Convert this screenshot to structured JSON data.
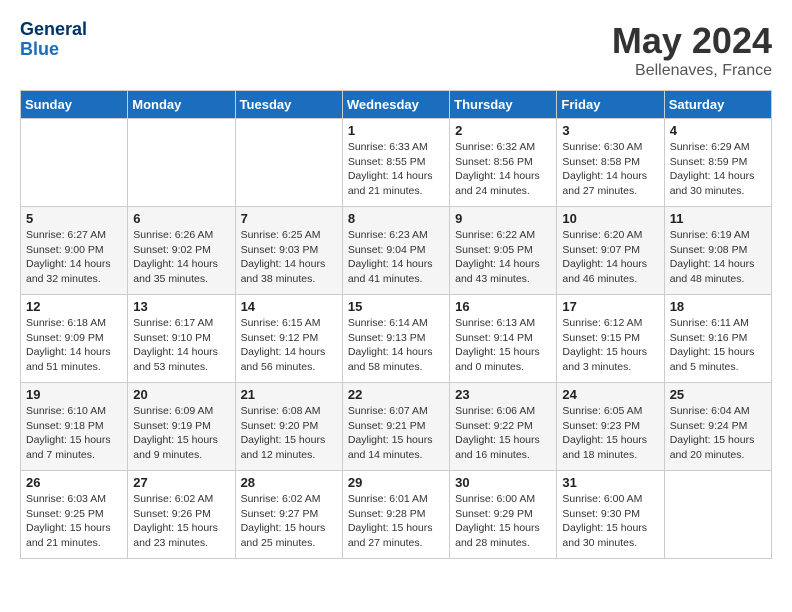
{
  "header": {
    "logo_line1": "General",
    "logo_line2": "Blue",
    "month": "May 2024",
    "location": "Bellenaves, France"
  },
  "weekdays": [
    "Sunday",
    "Monday",
    "Tuesday",
    "Wednesday",
    "Thursday",
    "Friday",
    "Saturday"
  ],
  "weeks": [
    [
      {
        "day": "",
        "info": ""
      },
      {
        "day": "",
        "info": ""
      },
      {
        "day": "",
        "info": ""
      },
      {
        "day": "1",
        "info": "Sunrise: 6:33 AM\nSunset: 8:55 PM\nDaylight: 14 hours\nand 21 minutes."
      },
      {
        "day": "2",
        "info": "Sunrise: 6:32 AM\nSunset: 8:56 PM\nDaylight: 14 hours\nand 24 minutes."
      },
      {
        "day": "3",
        "info": "Sunrise: 6:30 AM\nSunset: 8:58 PM\nDaylight: 14 hours\nand 27 minutes."
      },
      {
        "day": "4",
        "info": "Sunrise: 6:29 AM\nSunset: 8:59 PM\nDaylight: 14 hours\nand 30 minutes."
      }
    ],
    [
      {
        "day": "5",
        "info": "Sunrise: 6:27 AM\nSunset: 9:00 PM\nDaylight: 14 hours\nand 32 minutes."
      },
      {
        "day": "6",
        "info": "Sunrise: 6:26 AM\nSunset: 9:02 PM\nDaylight: 14 hours\nand 35 minutes."
      },
      {
        "day": "7",
        "info": "Sunrise: 6:25 AM\nSunset: 9:03 PM\nDaylight: 14 hours\nand 38 minutes."
      },
      {
        "day": "8",
        "info": "Sunrise: 6:23 AM\nSunset: 9:04 PM\nDaylight: 14 hours\nand 41 minutes."
      },
      {
        "day": "9",
        "info": "Sunrise: 6:22 AM\nSunset: 9:05 PM\nDaylight: 14 hours\nand 43 minutes."
      },
      {
        "day": "10",
        "info": "Sunrise: 6:20 AM\nSunset: 9:07 PM\nDaylight: 14 hours\nand 46 minutes."
      },
      {
        "day": "11",
        "info": "Sunrise: 6:19 AM\nSunset: 9:08 PM\nDaylight: 14 hours\nand 48 minutes."
      }
    ],
    [
      {
        "day": "12",
        "info": "Sunrise: 6:18 AM\nSunset: 9:09 PM\nDaylight: 14 hours\nand 51 minutes."
      },
      {
        "day": "13",
        "info": "Sunrise: 6:17 AM\nSunset: 9:10 PM\nDaylight: 14 hours\nand 53 minutes."
      },
      {
        "day": "14",
        "info": "Sunrise: 6:15 AM\nSunset: 9:12 PM\nDaylight: 14 hours\nand 56 minutes."
      },
      {
        "day": "15",
        "info": "Sunrise: 6:14 AM\nSunset: 9:13 PM\nDaylight: 14 hours\nand 58 minutes."
      },
      {
        "day": "16",
        "info": "Sunrise: 6:13 AM\nSunset: 9:14 PM\nDaylight: 15 hours\nand 0 minutes."
      },
      {
        "day": "17",
        "info": "Sunrise: 6:12 AM\nSunset: 9:15 PM\nDaylight: 15 hours\nand 3 minutes."
      },
      {
        "day": "18",
        "info": "Sunrise: 6:11 AM\nSunset: 9:16 PM\nDaylight: 15 hours\nand 5 minutes."
      }
    ],
    [
      {
        "day": "19",
        "info": "Sunrise: 6:10 AM\nSunset: 9:18 PM\nDaylight: 15 hours\nand 7 minutes."
      },
      {
        "day": "20",
        "info": "Sunrise: 6:09 AM\nSunset: 9:19 PM\nDaylight: 15 hours\nand 9 minutes."
      },
      {
        "day": "21",
        "info": "Sunrise: 6:08 AM\nSunset: 9:20 PM\nDaylight: 15 hours\nand 12 minutes."
      },
      {
        "day": "22",
        "info": "Sunrise: 6:07 AM\nSunset: 9:21 PM\nDaylight: 15 hours\nand 14 minutes."
      },
      {
        "day": "23",
        "info": "Sunrise: 6:06 AM\nSunset: 9:22 PM\nDaylight: 15 hours\nand 16 minutes."
      },
      {
        "day": "24",
        "info": "Sunrise: 6:05 AM\nSunset: 9:23 PM\nDaylight: 15 hours\nand 18 minutes."
      },
      {
        "day": "25",
        "info": "Sunrise: 6:04 AM\nSunset: 9:24 PM\nDaylight: 15 hours\nand 20 minutes."
      }
    ],
    [
      {
        "day": "26",
        "info": "Sunrise: 6:03 AM\nSunset: 9:25 PM\nDaylight: 15 hours\nand 21 minutes."
      },
      {
        "day": "27",
        "info": "Sunrise: 6:02 AM\nSunset: 9:26 PM\nDaylight: 15 hours\nand 23 minutes."
      },
      {
        "day": "28",
        "info": "Sunrise: 6:02 AM\nSunset: 9:27 PM\nDaylight: 15 hours\nand 25 minutes."
      },
      {
        "day": "29",
        "info": "Sunrise: 6:01 AM\nSunset: 9:28 PM\nDaylight: 15 hours\nand 27 minutes."
      },
      {
        "day": "30",
        "info": "Sunrise: 6:00 AM\nSunset: 9:29 PM\nDaylight: 15 hours\nand 28 minutes."
      },
      {
        "day": "31",
        "info": "Sunrise: 6:00 AM\nSunset: 9:30 PM\nDaylight: 15 hours\nand 30 minutes."
      },
      {
        "day": "",
        "info": ""
      }
    ]
  ]
}
